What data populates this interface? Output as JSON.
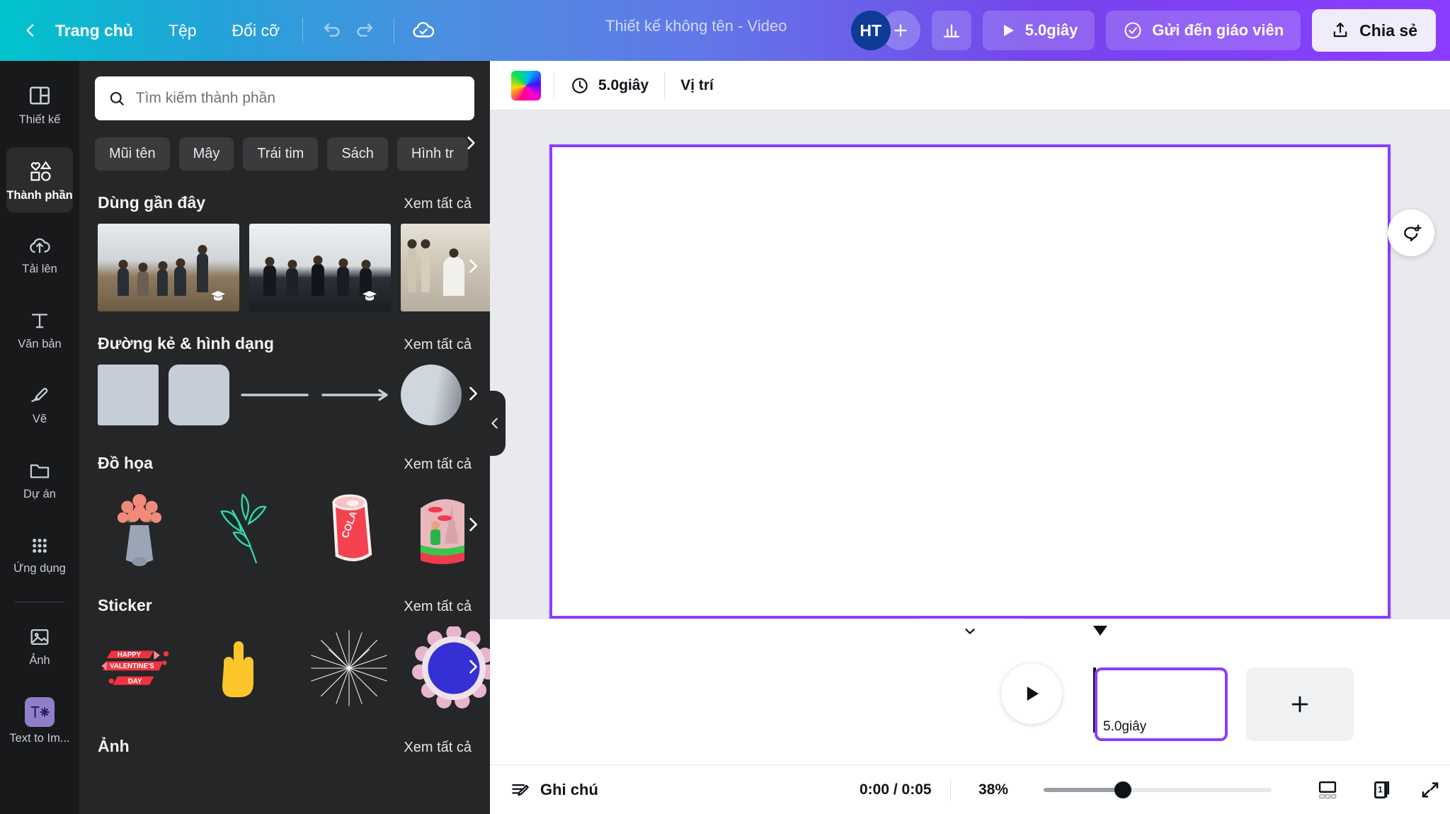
{
  "topbar": {
    "back_icon": "chevron-left-icon",
    "home_label": "Trang chủ",
    "file_label": "Tệp",
    "resize_label": "Đổi cỡ",
    "undo_icon": "undo-icon",
    "redo_icon": "redo-icon",
    "cloud_icon": "cloud-check-icon",
    "doc_title": "Thiết kế không tên - Video",
    "avatar_initials": "HT",
    "add_collaborator_icon": "plus-icon",
    "analytics_icon": "bar-chart-icon",
    "play_icon": "play-icon",
    "duration_label": "5.0giây",
    "send_teacher_icon": "check-circle-icon",
    "send_teacher_label": "Gửi đến giáo viên",
    "share_icon": "share-upload-icon",
    "share_label": "Chia sẻ",
    "accent_start": "#00c4cc",
    "accent_end": "#8b3dff"
  },
  "rail": {
    "items": [
      {
        "icon": "design-layout-icon",
        "label": "Thiết kế",
        "active": false
      },
      {
        "icon": "elements-shapes-icon",
        "label": "Thành phần",
        "active": true
      },
      {
        "icon": "cloud-upload-icon",
        "label": "Tải lên",
        "active": false
      },
      {
        "icon": "text-t-icon",
        "label": "Văn bản",
        "active": false
      },
      {
        "icon": "pen-draw-icon",
        "label": "Vẽ",
        "active": false
      },
      {
        "icon": "folder-icon",
        "label": "Dự án",
        "active": false
      },
      {
        "icon": "grid-apps-icon",
        "label": "Ứng dụng",
        "active": false
      },
      {
        "icon": "photo-image-icon",
        "label": "Ảnh",
        "active": false
      },
      {
        "icon": "text-to-image-icon",
        "label": "Text to Im...",
        "active": false
      }
    ]
  },
  "panel": {
    "search": {
      "placeholder": "Tìm kiếm thành phần",
      "value": "",
      "icon": "search-icon"
    },
    "chips": [
      "Mũi tên",
      "Mây",
      "Trái tim",
      "Sách",
      "Hình tr"
    ],
    "chips_next_icon": "chevron-right-icon",
    "see_all_label": "Xem tất cả",
    "sections": [
      {
        "title": "Dùng gần đây",
        "see_all": "Xem tất cả"
      },
      {
        "title": "Đường kẻ & hình dạng",
        "see_all": "Xem tất cả"
      },
      {
        "title": "Đồ họa",
        "see_all": "Xem tất cả"
      },
      {
        "title": "Sticker",
        "see_all": "Xem tất cả"
      },
      {
        "title": "Ảnh",
        "see_all": "Xem tất cả"
      }
    ],
    "collapse_icon": "chevron-left-icon"
  },
  "canvas_toolbar": {
    "color_swatch_icon": "color-wheel-icon",
    "timer_icon": "clock-icon",
    "duration_label": "5.0giây",
    "position_label": "Vị trí"
  },
  "canvas": {
    "selection_color": "#8b3dff",
    "comment_icon": "add-comment-icon",
    "magic_icon": "magic-sparkles-icon"
  },
  "timeline": {
    "collapse_icon": "chevron-down-icon",
    "play_icon": "play-icon",
    "page_duration_label": "5.0giây",
    "add_page_icon": "plus-icon"
  },
  "bottombar": {
    "notes_icon": "notes-pencil-icon",
    "notes_label": "Ghi chú",
    "time_label": "0:00 / 0:05",
    "zoom_label": "38%",
    "zoom_value": 38,
    "grid_view_icon": "grid-view-icon",
    "pages_icon": "pages-icon",
    "pages_count": "1",
    "fullscreen_icon": "expand-icon",
    "help_icon": "help-circle-icon"
  }
}
